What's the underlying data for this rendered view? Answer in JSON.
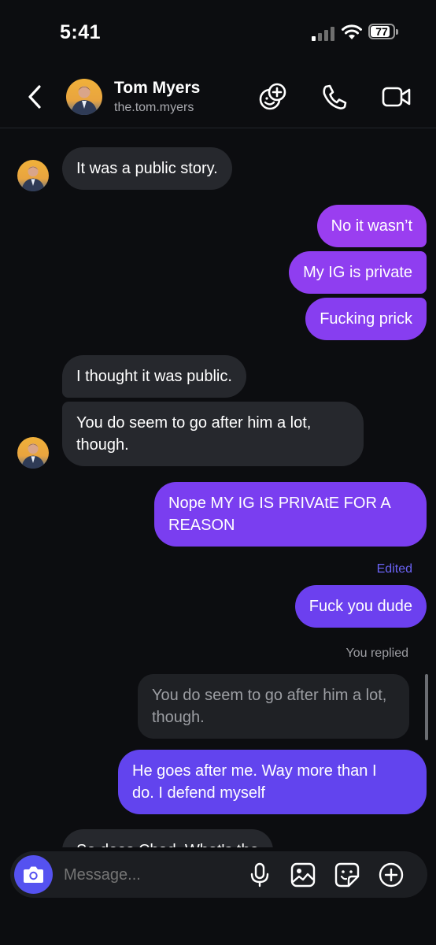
{
  "status_bar": {
    "time": "5:41",
    "battery": "77"
  },
  "header": {
    "name": "Tom Myers",
    "handle": "the.tom.myers"
  },
  "messages": {
    "m1": "It was a public story.",
    "m2": "No it wasn’t",
    "m3": "My IG is private",
    "m4": "Fucking prick",
    "m5": "I thought it was public.",
    "m6": "You do seem to go after him a lot,\nthough.",
    "m7": "Nope MY IG IS PRIVAtE FOR A\nREASON",
    "m8_label": "Edited",
    "m8": "Fuck you dude",
    "reply_label": "You replied",
    "reply_quote": "You do seem to go after him a lot,\nthough.",
    "m9": "He goes after me. Way more than I\ndo. I defend myself",
    "m10_partial": "So does Chad. What's the"
  },
  "composer": {
    "placeholder": "Message..."
  },
  "colors": {
    "outgoing_purple": "#8a3df0",
    "outgoing_violet": "#6244ee",
    "incoming": "#26282d",
    "accent_edited": "#6b63f5"
  },
  "icons": {
    "back": "chevron-left-icon",
    "effects": "emoji-plus-icon",
    "call": "phone-icon",
    "video": "video-camera-icon",
    "camera": "camera-icon",
    "mic": "microphone-icon",
    "gallery": "image-icon",
    "sticker": "sticker-icon",
    "more": "plus-circle-icon"
  }
}
